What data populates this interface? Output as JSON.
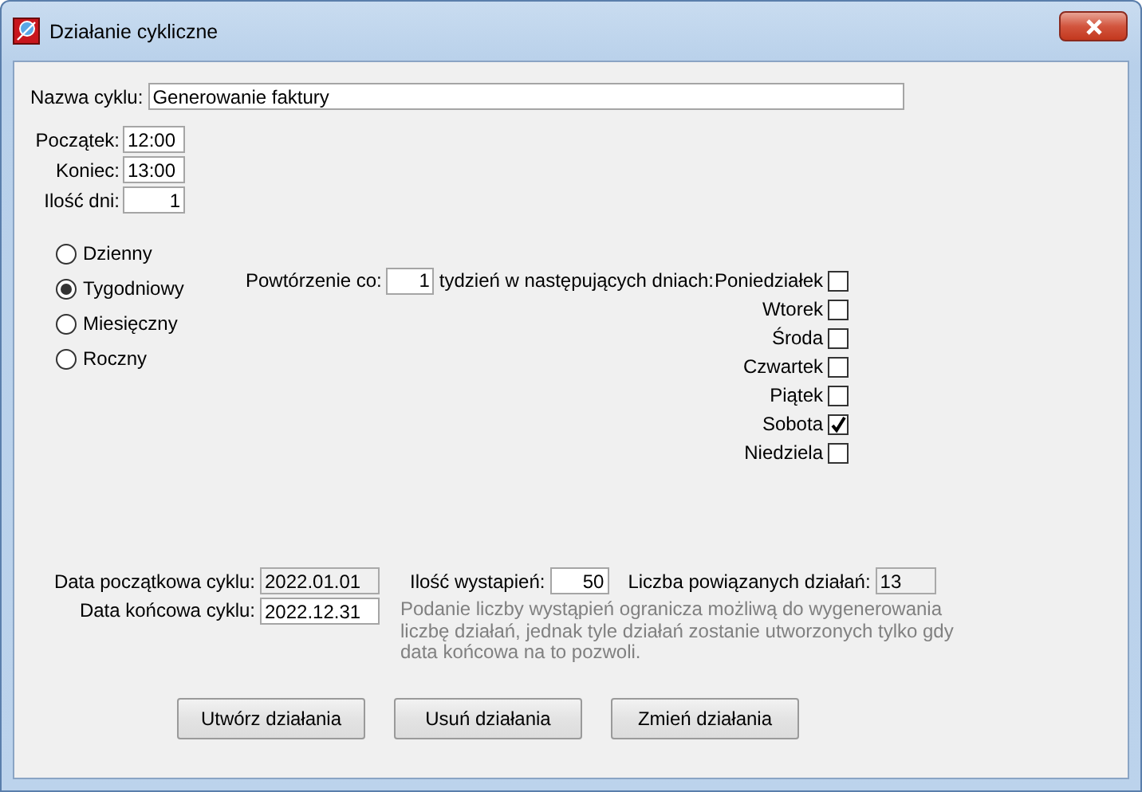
{
  "window": {
    "title": "Działanie cykliczne"
  },
  "name_field": {
    "label": "Nazwa cyklu:",
    "value": "Generowanie faktury"
  },
  "time_fields": [
    {
      "label": "Początek:",
      "value": "12:00",
      "kind": "text"
    },
    {
      "label": "Koniec:",
      "value": "13:00",
      "kind": "text"
    },
    {
      "label": "Ilość dni:",
      "value": "1",
      "kind": "number"
    }
  ],
  "frequency": [
    {
      "label": "Dzienny",
      "selected": false
    },
    {
      "label": "Tygodniowy",
      "selected": true
    },
    {
      "label": "Miesięczny",
      "selected": false
    },
    {
      "label": "Roczny",
      "selected": false
    }
  ],
  "repeat": {
    "label": "Powtórzenie co:",
    "value": "1",
    "suffix": "tydzień w następujących dniach:"
  },
  "days": [
    {
      "label": "Poniedziałek",
      "checked": false
    },
    {
      "label": "Wtorek",
      "checked": false
    },
    {
      "label": "Środa",
      "checked": false
    },
    {
      "label": "Czwartek",
      "checked": false
    },
    {
      "label": "Piątek",
      "checked": false
    },
    {
      "label": "Sobota",
      "checked": true
    },
    {
      "label": "Niedziela",
      "checked": false
    }
  ],
  "cycle_start": {
    "label": "Data początkowa cyklu:",
    "value": "2022.01.01",
    "disabled": true
  },
  "occurrences": {
    "label": "Ilość wystapień:",
    "value": "50",
    "disabled": false
  },
  "linked": {
    "label": "Liczba powiązanych działań:",
    "value": "13",
    "disabled": true
  },
  "cycle_end": {
    "label": "Data końcowa cyklu:",
    "value": "2022.12.31",
    "disabled": false
  },
  "hint": "Podanie liczby wystąpień ogranicza możliwą do wygenerowania liczbę działań, jednak tyle działań zostanie utworzonych tylko gdy data końcowa na to pozwoli.",
  "buttons": [
    "Utwórz działania",
    "Usuń działania",
    "Zmień działania"
  ]
}
